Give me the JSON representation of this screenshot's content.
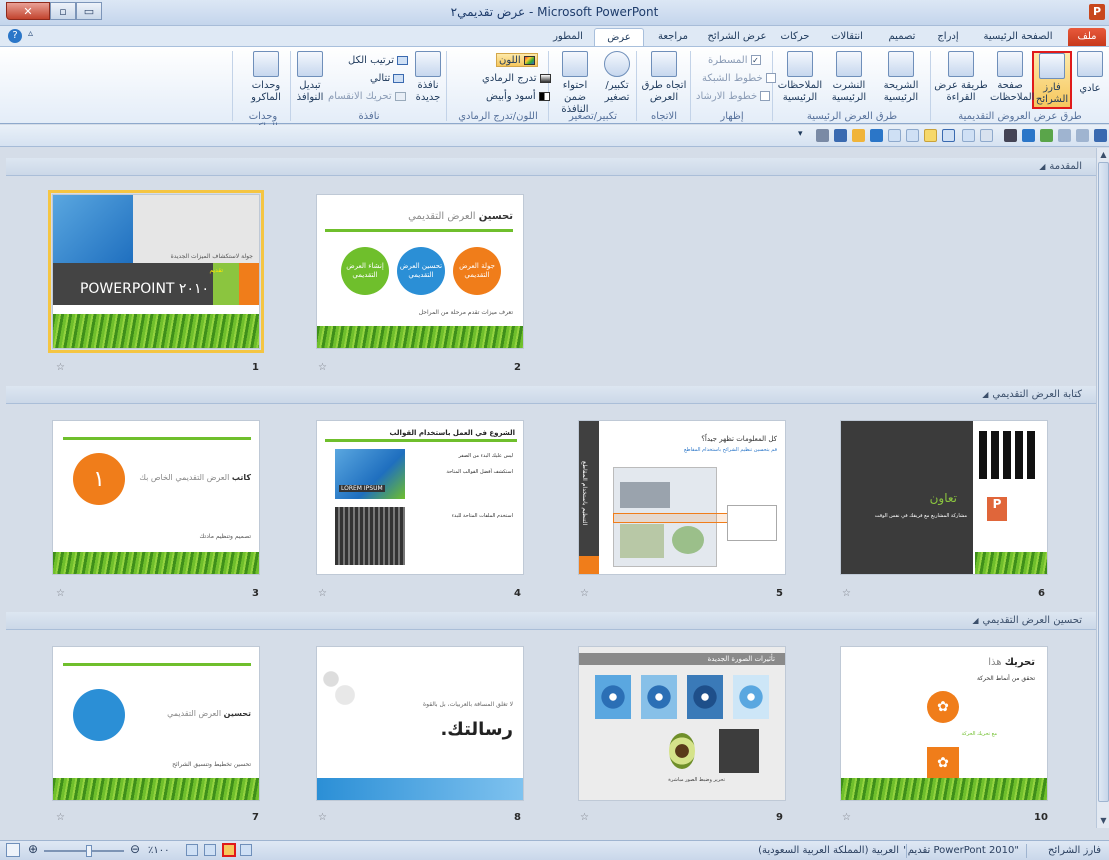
{
  "window": {
    "title": "عرض تقديمي٢ - Microsoft PowerPont",
    "app_letter": "P",
    "min_glyph": "▭",
    "restore_glyph": "▫",
    "close_glyph": "✕"
  },
  "tabs": {
    "file": "ملف",
    "home": "الصفحة الرئيسية",
    "insert": "إدراج",
    "design": "تصميم",
    "transitions": "انتقالات",
    "animations": "حركات",
    "slideshow": "عرض الشرائح",
    "review": "مراجعة",
    "view": "عرض",
    "developer": "المطور"
  },
  "ribbon": {
    "views_group": {
      "label": "طرق عرض العروض التقديمية",
      "normal": "عادي",
      "sorter_line1": "فارز",
      "sorter_line2": "الشرائح",
      "notes_line1": "صفحة",
      "notes_line2": "الملاحظات",
      "reading_line1": "طريقة عرض",
      "reading_line2": "القراءة"
    },
    "master_group": {
      "label": "طرق العرض الرئيسية",
      "slide_master_line1": "الشريحة",
      "slide_master_line2": "الرئيسية",
      "handout_master_line1": "النشرت",
      "handout_master_line2": "الرئيسية",
      "notes_master_line1": "الملاحظات",
      "notes_master_line2": "الرئيسية"
    },
    "show_group": {
      "label": "إظهار",
      "ruler": "المسطرة",
      "gridlines": "خطوط الشبكة",
      "guides": "خطوط الارشاد"
    },
    "direction_group": {
      "label": "الاتجاه",
      "line1": "اتجاه طرق",
      "line2": "العرض"
    },
    "zoom_group": {
      "label": "تكبير/تصغير",
      "zoom": "تكبير/تصغير",
      "fit_line1": "احتواء ضمن",
      "fit_line2": "النافذة"
    },
    "color_group": {
      "label": "اللون/تدرج الرمادي",
      "color": "اللون",
      "grayscale": "تدرج الرمادي",
      "bw": "أسود وأبيض"
    },
    "window_group": {
      "label": "نافذة",
      "new_window_line1": "نافذة",
      "new_window_line2": "جديدة",
      "arrange_all": "ترتيب الكل",
      "cascade": "تتالي",
      "move_split": "تحريك الانقسام",
      "switch_line1": "تبديل",
      "switch_line2": "النوافذ"
    },
    "macros_group": {
      "label": "وحدات الماكرو",
      "macros_line1": "وحدات",
      "macros_line2": "الماكرو"
    }
  },
  "sections": [
    {
      "title": "المقدمة"
    },
    {
      "title": "كتابة العرض التقديمي"
    },
    {
      "title": "تحسين العرض التقديمي"
    }
  ],
  "slides": {
    "s1": {
      "number": "1",
      "title": "POWERPOINT ٢٠١٠",
      "sub": "جولة لاستكشاف الميزات الجديدة",
      "tag": "تقديم"
    },
    "s2": {
      "number": "2",
      "title_bold": "تحسين",
      "title_rest": "العرض التقديمي",
      "c1": "إنشاء العرض التقديمي",
      "c2": "تحسين العرض التقديمي",
      "c3": "جولة العرض التقديمي",
      "footer": "تعرف ميزات تقدم مرحلة من المراحل"
    },
    "s3": {
      "number": "3",
      "title_bold": "كاتب",
      "title_rest": "العرض التقديمي الخاص بك",
      "circle": "١",
      "footer": "تصميم وتنظيم مادتك"
    },
    "s4": {
      "number": "4",
      "title": "الشروع في العمل باستخدام القوالب",
      "box_text": "LOREM IPSUM",
      "p1": "ليس عليك البدء من الصفر",
      "p2": "استكشف أفضل القوالب المتاحة",
      "p3": "استخدم الملفات المتاحة للبدء"
    },
    "s5": {
      "number": "5",
      "side": "التنظيم باستخدام المقاطع",
      "title": "كل المعلومات تظهر جيداً؟",
      "body": "قم بتحسين تنظيم الشرائح باستخدام المقاطع"
    },
    "s6": {
      "number": "6",
      "title": "تعاون",
      "body": "مشاركة المشاريع مع فريقك في نفس الوقت"
    },
    "s7": {
      "number": "7",
      "title_bold": "تحسين",
      "title_rest": "العرض التقديمي",
      "footer": "تحسين تخطيط وتنسيق الشرائح"
    },
    "s8": {
      "number": "8",
      "title": "رسالتك.",
      "sub": "لا تغلق المسافة بالعربيات، بل بالقوة"
    },
    "s9": {
      "number": "9",
      "title": "تأثيرات الصورة الجديدة",
      "caption": "تحرير وضبط الصور مباشرة"
    },
    "s10": {
      "number": "10",
      "title_bold": "تحريك",
      "title_rest": "هذا",
      "sub": "تحقق من أنماط الحركة",
      "note": "مع تحريك الحركة"
    }
  },
  "status": {
    "view_name": "فارز الشرائح",
    "file_name": "\"تقديم PowerPont 2010\"",
    "language": "العربية (المملكة العربية السعودية)",
    "zoom": "٪١٠٠"
  },
  "colors": {
    "accent_red": "#e01a1a",
    "selected_slide_outline": "#f5c542",
    "orange": "#f07d1a",
    "green": "#6fbf2c",
    "blue": "#2b8fd6"
  }
}
